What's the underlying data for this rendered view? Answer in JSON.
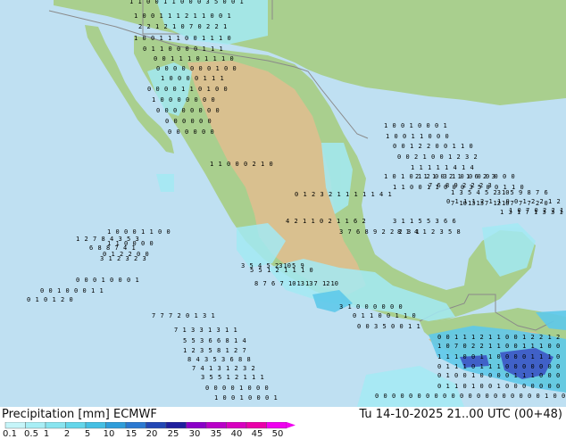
{
  "legend": {
    "title": "Precipitation [mm]",
    "model": "ECMWF",
    "scale_values": [
      "0.1",
      "0.5",
      "1",
      "2",
      "5",
      "10",
      "15",
      "20",
      "25",
      "30",
      "35",
      "40",
      "45",
      "50"
    ],
    "scale_colors": [
      "#c6f5f9",
      "#a8eef5",
      "#88e4ef",
      "#64d6ea",
      "#45bfe3",
      "#2f9dda",
      "#2b79d1",
      "#2247b5",
      "#1f1f9e",
      "#8a00c8",
      "#b900c8",
      "#d800c0",
      "#ea00aa",
      "#f000f0"
    ]
  },
  "timestamp": "Tu 14-10-2025 21..00 UTC (00+48)",
  "map_colors": {
    "ocean": "#bfe0f2",
    "lowland": "#a9cf8e",
    "highland": "#d9c08f",
    "border": "#8a8a8a",
    "precip_light": "#a3eaf4",
    "precip_medium": "#5ec9ea",
    "precip_heavy": "#3a4fc4"
  },
  "point_values": [
    "1",
    "1",
    "0",
    "0",
    "1",
    "1",
    "0",
    "0",
    "0",
    "3",
    "5",
    "0",
    "0",
    "1",
    "1",
    "0",
    "0",
    "1",
    "1",
    "1",
    "2",
    "1",
    "1",
    "0",
    "0",
    "1",
    "2",
    "2",
    "1",
    "2",
    "1",
    "0",
    "7",
    "0",
    "2",
    "2",
    "1",
    "1",
    "0",
    "0",
    "1",
    "1",
    "1",
    "0",
    "0",
    "1",
    "1",
    "1",
    "0",
    "0",
    "1",
    "1",
    "0",
    "0",
    "0",
    "0",
    "1",
    "1",
    "1",
    "0",
    "0",
    "1",
    "1",
    "1",
    "0",
    "1",
    "1",
    "1",
    "0",
    "0",
    "0",
    "0",
    "0",
    "0",
    "0",
    "0",
    "1",
    "0",
    "0",
    "1",
    "0",
    "0",
    "0",
    "0",
    "1",
    "1",
    "1",
    "0",
    "0",
    "0",
    "0",
    "1",
    "1",
    "0",
    "1",
    "0",
    "0",
    "1",
    "0",
    "0",
    "0",
    "0",
    "0",
    "0",
    "0",
    "0",
    "0",
    "0",
    "0",
    "0",
    "0",
    "0",
    "0",
    "0",
    "0",
    "0",
    "0",
    "0",
    "0",
    "0",
    "0",
    "0",
    "0",
    "0",
    "0",
    "1",
    "0",
    "0",
    "1",
    "0",
    "0",
    "0",
    "1",
    "1",
    "0",
    "0",
    "1",
    "1",
    "0",
    "0",
    "0",
    "0",
    "0",
    "1",
    "2",
    "2",
    "0",
    "0",
    "1",
    "1",
    "0",
    "0",
    "0",
    "2",
    "1",
    "0",
    "0",
    "1",
    "2",
    "3",
    "2",
    "1",
    "1",
    "1",
    "1",
    "1",
    "4",
    "1",
    "4",
    "2",
    "1",
    "1",
    "0",
    "2",
    "1",
    "1",
    "6",
    "2",
    "3",
    "7",
    "6",
    "8",
    "9",
    "2",
    "2",
    "2",
    "3",
    "1",
    "3",
    "5",
    "4",
    "5",
    "23",
    "10",
    "5",
    "9",
    "8",
    "7",
    "6",
    "7",
    "10",
    "13",
    "13",
    "7",
    "12",
    "10",
    "7",
    "7",
    "7",
    "2",
    "0",
    "1",
    "3",
    "1",
    "7",
    "1",
    "3",
    "3",
    "1",
    "3",
    "1",
    "1",
    "5",
    "5",
    "3",
    "6",
    "6",
    "8",
    "1",
    "4",
    "1",
    "2",
    "3",
    "5",
    "8",
    "1",
    "2",
    "7",
    "8",
    "4",
    "3",
    "5",
    "3",
    "6",
    "8",
    "8",
    "7",
    "4",
    "1",
    "3",
    "1",
    "2",
    "3",
    "2",
    "3",
    "5",
    "5",
    "1",
    "2",
    "1",
    "1",
    "1",
    "0",
    "0",
    "0",
    "0",
    "1",
    "0",
    "0",
    "0",
    "1",
    "0",
    "0",
    "1",
    "0",
    "0",
    "0",
    "1",
    "1",
    "0",
    "1",
    "0",
    "1",
    "2",
    "0",
    "3",
    "1",
    "0",
    "0",
    "0",
    "0",
    "0",
    "0",
    "0"
  ]
}
